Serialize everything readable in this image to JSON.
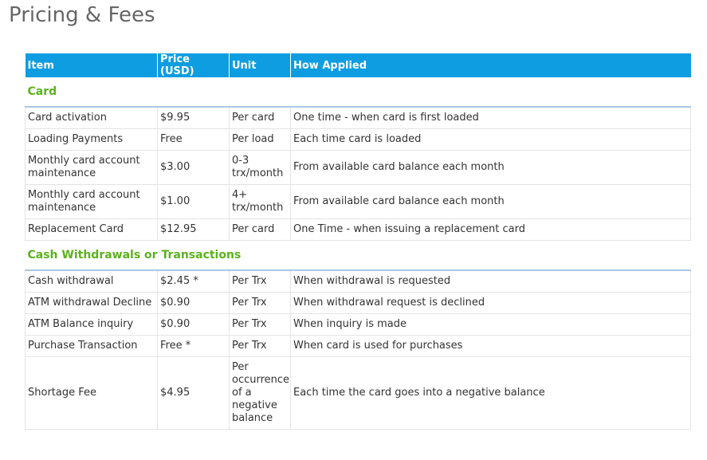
{
  "page": {
    "title": "Pricing & Fees"
  },
  "table": {
    "headers": [
      "Item",
      "Price (USD)",
      "Unit",
      "How Applied"
    ],
    "sections": [
      {
        "title": "Card",
        "rows": [
          [
            "Card activation",
            "$9.95",
            "Per card",
            "One time - when card is first loaded"
          ],
          [
            "Loading Payments",
            "Free",
            "Per load",
            "Each time card is loaded"
          ],
          [
            "Monthly card account maintenance",
            "$3.00",
            "0-3 trx/month",
            "From available card balance each month"
          ],
          [
            "Monthly card account maintenance",
            "$1.00",
            "4+ trx/month",
            "From available card balance each month"
          ],
          [
            "Replacement Card",
            "$12.95",
            "Per card",
            "One Time - when issuing a replacement card"
          ]
        ]
      },
      {
        "title": "Cash Withdrawals or Transactions",
        "rows": [
          [
            "Cash withdrawal",
            "$2.45 *",
            "Per Trx",
            "When withdrawal is requested"
          ],
          [
            "ATM withdrawal Decline",
            "$0.90",
            "Per Trx",
            "When withdrawal request is declined"
          ],
          [
            "ATM Balance inquiry",
            "$0.90",
            "Per Trx",
            "When inquiry is made"
          ],
          [
            "Purchase Transaction",
            "Free *",
            "Per Trx",
            "When card is used for purchases"
          ],
          [
            "Shortage Fee",
            "$4.95",
            "Per occurrence of a negative balance",
            "Each time the card goes into a negative balance"
          ]
        ]
      }
    ]
  },
  "colors": {
    "header_bg": "#0f9de1",
    "section_title": "#5cb21e",
    "title_text": "#666666"
  }
}
